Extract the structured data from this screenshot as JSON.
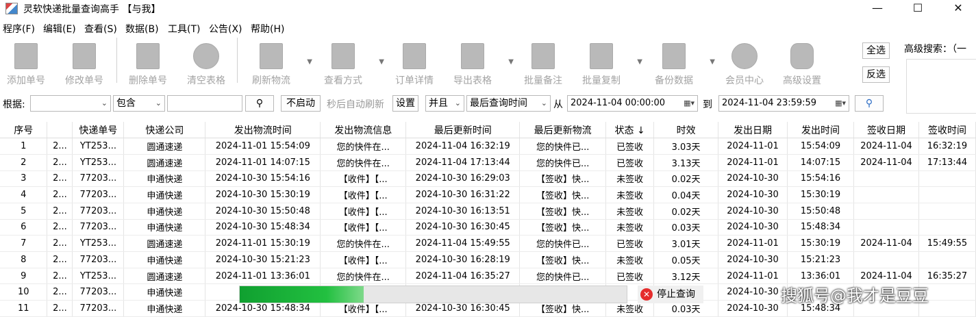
{
  "window": {
    "title": "灵软快递批量查询高手 【与我】",
    "minimize": "—",
    "maximize": "☐",
    "close": "✕"
  },
  "menu": [
    "程序(F)",
    "编辑(E)",
    "查看(S)",
    "数据(B)",
    "工具(T)",
    "公告(X)",
    "帮助(H)"
  ],
  "toolbar": [
    {
      "label": "添加单号",
      "icon": "add-doc-icon"
    },
    {
      "label": "修改单号",
      "icon": "edit-doc-icon"
    },
    {
      "label": "删除单号",
      "icon": "delete-doc-icon"
    },
    {
      "label": "清空表格",
      "icon": "clear-table-icon"
    },
    {
      "label": "刷新物流",
      "icon": "refresh-doc-icon"
    },
    {
      "label": "查看方式",
      "icon": "view-mode-icon"
    },
    {
      "label": "订单详情",
      "icon": "order-detail-icon"
    },
    {
      "label": "导出表格",
      "icon": "export-table-icon"
    },
    {
      "label": "批量备注",
      "icon": "batch-note-icon"
    },
    {
      "label": "批量复制",
      "icon": "batch-copy-icon"
    },
    {
      "label": "备份数据",
      "icon": "backup-icon"
    },
    {
      "label": "会员中心",
      "icon": "clock-icon"
    },
    {
      "label": "高级设置",
      "icon": "gear-icon"
    }
  ],
  "side": {
    "select_all": "全选",
    "invert": "反选",
    "adv_search": "高级搜索：（一"
  },
  "filter": {
    "by_label": "根据:",
    "field_value": "",
    "match_value": "包含",
    "search_text": "",
    "not_start": "不启动",
    "auto_refresh": "秒后自动刷新",
    "settings": "设置",
    "logic": "并且",
    "time_field": "最后查询时间",
    "from_label": "从",
    "from_value": "2024-11-04 00:00:00",
    "to_label": "到",
    "to_value": "2024-11-04 23:59:59"
  },
  "table": {
    "headers": [
      "序号",
      "",
      "快递单号",
      "快递公司",
      "发出物流时间",
      "发出物流信息",
      "最后更新时间",
      "最后更新物流",
      "状态 ↓",
      "时效",
      "发出日期",
      "发出时间",
      "签收日期",
      "签收时间"
    ],
    "rows": [
      [
        "1",
        "2...",
        "YT253...",
        "圆通速递",
        "2024-11-01  15:54:09",
        "您的快件在...",
        "2024-11-04  16:32:19",
        "您的快件已...",
        "已签收",
        "3.03天",
        "2024-11-01",
        "15:54:09",
        "2024-11-04",
        "16:32:19"
      ],
      [
        "2",
        "2...",
        "YT253...",
        "圆通速递",
        "2024-11-01  14:07:15",
        "您的快件在...",
        "2024-11-04  17:13:44",
        "您的快件已...",
        "已签收",
        "3.13天",
        "2024-11-01",
        "14:07:15",
        "2024-11-04",
        "17:13:44"
      ],
      [
        "3",
        "2...",
        "77203...",
        "申通快递",
        "2024-10-30  15:54:16",
        "【收件】【...",
        "2024-10-30  16:29:03",
        "【签收】快...",
        "未签收",
        "0.02天",
        "2024-10-30",
        "15:54:16",
        "",
        ""
      ],
      [
        "4",
        "2...",
        "77203...",
        "申通快递",
        "2024-10-30  15:30:19",
        "【收件】【...",
        "2024-10-30  16:31:22",
        "【签收】快...",
        "未签收",
        "0.04天",
        "2024-10-30",
        "15:30:19",
        "",
        ""
      ],
      [
        "5",
        "2...",
        "77203...",
        "申通快递",
        "2024-10-30  15:50:48",
        "【收件】【...",
        "2024-10-30  16:13:51",
        "【签收】快...",
        "未签收",
        "0.02天",
        "2024-10-30",
        "15:50:48",
        "",
        ""
      ],
      [
        "6",
        "2...",
        "77203...",
        "申通快递",
        "2024-10-30  15:48:34",
        "【收件】【...",
        "2024-10-30  16:30:45",
        "【签收】快...",
        "未签收",
        "0.03天",
        "2024-10-30",
        "15:48:34",
        "",
        ""
      ],
      [
        "7",
        "2...",
        "YT253...",
        "圆通速递",
        "2024-11-01  15:30:19",
        "您的快件在...",
        "2024-11-04  15:49:55",
        "您的快件已...",
        "已签收",
        "3.01天",
        "2024-11-01",
        "15:30:19",
        "2024-11-04",
        "15:49:55"
      ],
      [
        "8",
        "2...",
        "77203...",
        "申通快递",
        "2024-10-30  15:21:23",
        "【收件】【...",
        "2024-10-30  16:28:19",
        "【签收】快...",
        "未签收",
        "0.05天",
        "2024-10-30",
        "15:21:23",
        "",
        ""
      ],
      [
        "9",
        "2...",
        "YT253...",
        "圆通速递",
        "2024-11-01  13:36:01",
        "您的快件在...",
        "2024-11-04  16:35:27",
        "您的快件已...",
        "已签收",
        "3.12天",
        "2024-11-01",
        "13:36:01",
        "2024-11-04",
        "16:35:27"
      ],
      [
        "10",
        "2...",
        "77203...",
        "申通快递",
        "2024-",
        "",
        "",
        "",
        "",
        "",
        "2024-10-30",
        "",
        "",
        ""
      ],
      [
        "11",
        "2...",
        "77203...",
        "申通快递",
        "2024-10-30  15:48:34",
        "【收件】【...",
        "2024-10-30  16:30:45",
        "【签收】快...",
        "未签收",
        "0.03天",
        "2024-10-30",
        "15:48:34",
        "",
        ""
      ]
    ]
  },
  "progress": {
    "percent": 32,
    "stop_label": "停止查询"
  },
  "watermark": "搜狐号@我才是豆豆"
}
